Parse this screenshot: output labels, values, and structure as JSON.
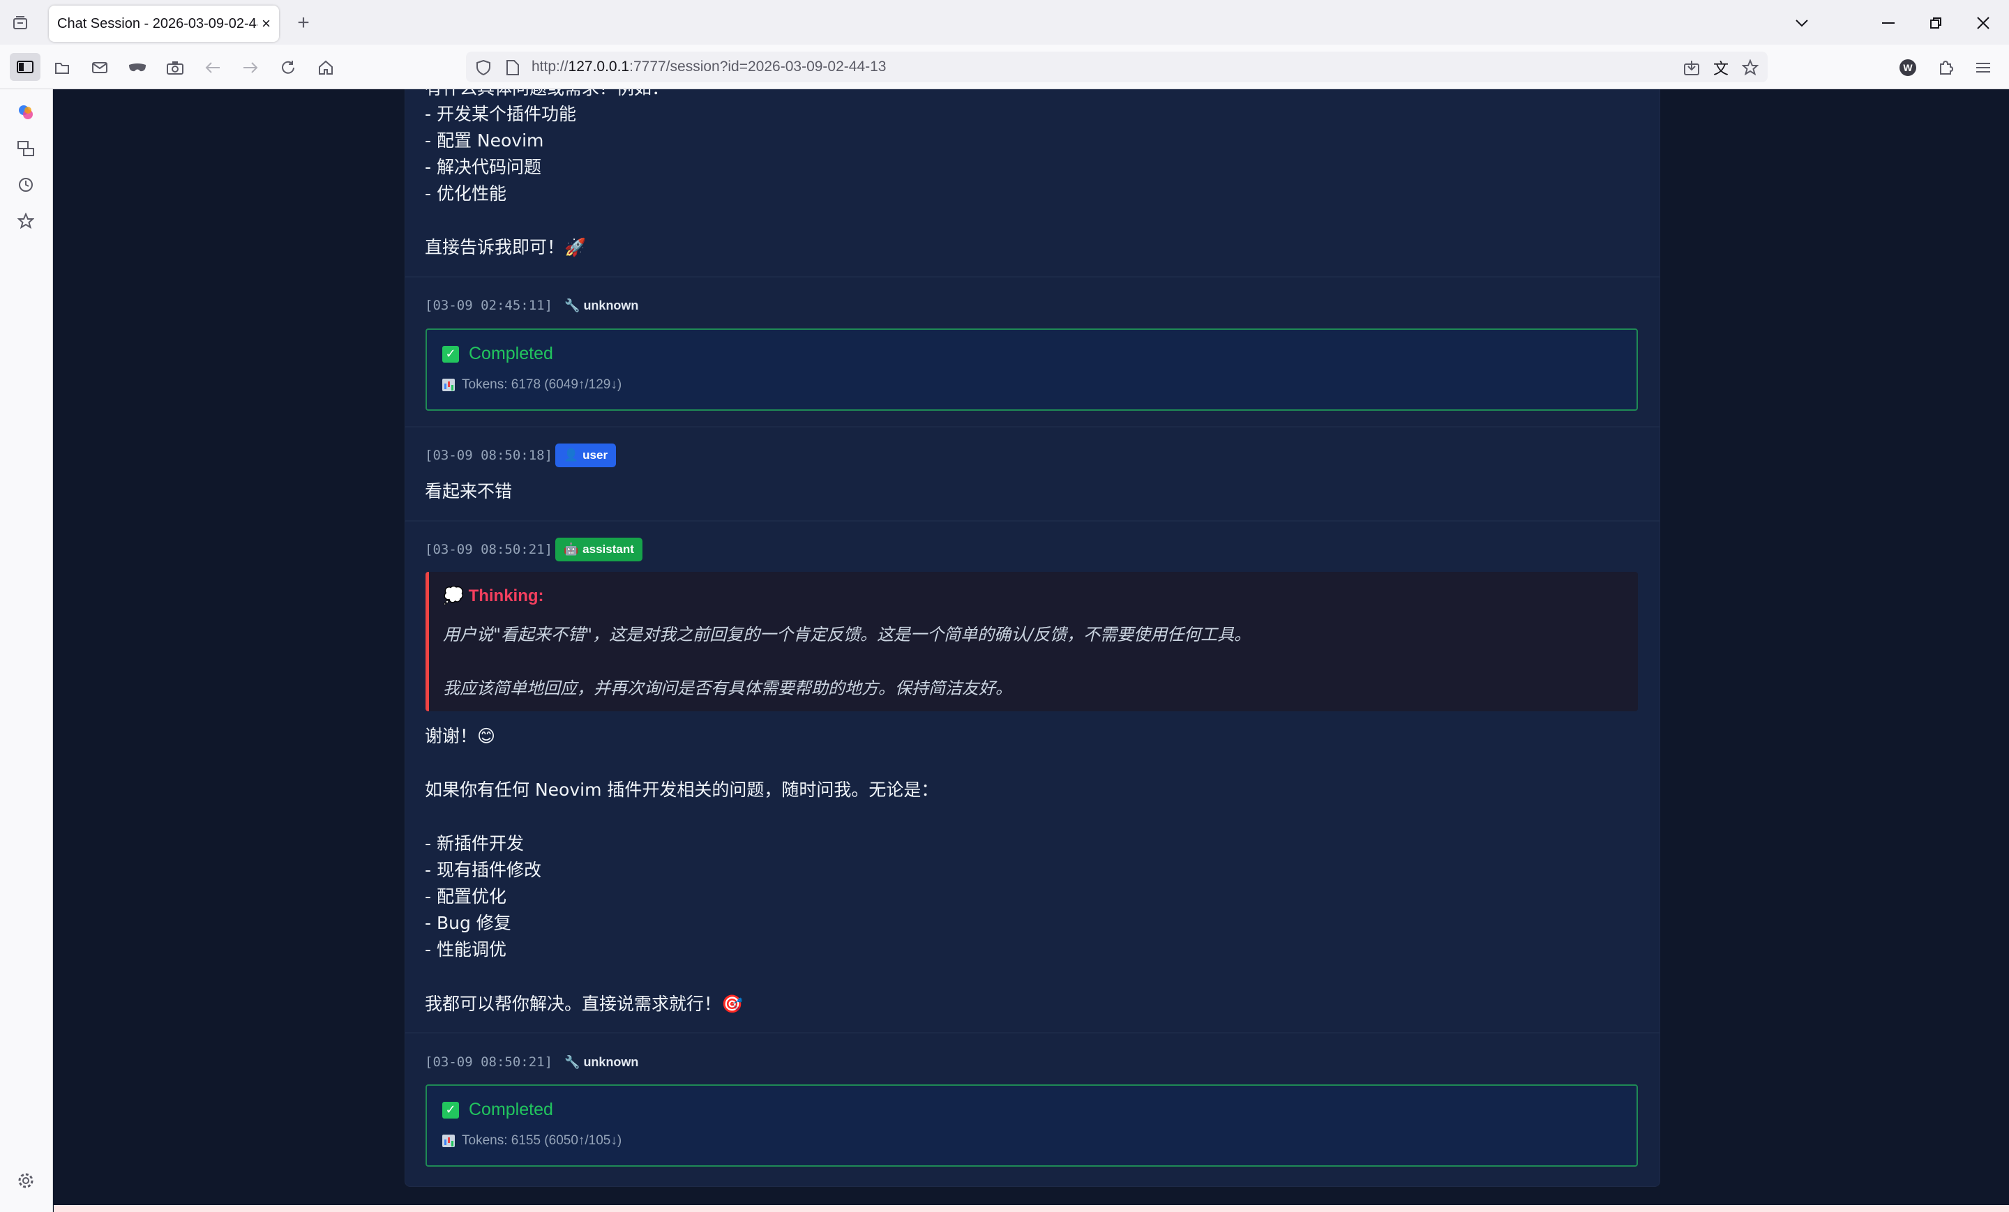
{
  "browser": {
    "tab_title": "Chat Session - 2026-03-09-02-44-13",
    "url_prefix": "http://",
    "url_host": "127.0.0.1",
    "url_rest": ":7777/session?id=2026-03-09-02-44-13",
    "new_tab": "+",
    "close_tab": "×"
  },
  "messages": {
    "top_list": {
      "cut_line": "有什么具体问题或需求？例如：",
      "items": [
        "- 开发某个插件功能",
        "- 配置 Neovim",
        "- 解决代码问题",
        "- 优化性能"
      ],
      "closing": "直接告诉我即可！🚀"
    },
    "status1": {
      "timestamp": "[03-09 02:45:11]",
      "role_icon": "🔧",
      "role": "unknown",
      "status": "Completed",
      "tokens": "Tokens: 6178 (6049↑/129↓)"
    },
    "user1": {
      "timestamp": "[03-09 08:50:18]",
      "role_icon": "👤",
      "role": "user",
      "text": "看起来不错"
    },
    "assistant1": {
      "timestamp": "[03-09 08:50:21]",
      "role_icon": "🤖",
      "role": "assistant",
      "thinking_icon": "💭",
      "thinking_title": "Thinking:",
      "thinking_line1": "用户说\"看起来不错\"，这是对我之前回复的一个肯定反馈。这是一个简单的确认/反馈，不需要使用任何工具。",
      "thinking_line2": "我应该简单地回应，并再次询问是否有具体需要帮助的地方。保持简洁友好。",
      "thanks": "谢谢！😊",
      "intro": "如果你有任何 Neovim 插件开发相关的问题，随时问我。无论是：",
      "items": [
        "- 新插件开发",
        "- 现有插件修改",
        "- 配置优化",
        "- Bug 修复",
        "- 性能调优"
      ],
      "closing": "我都可以帮你解决。直接说需求就行！🎯"
    },
    "status2": {
      "timestamp": "[03-09 08:50:21]",
      "role_icon": "🔧",
      "role": "unknown",
      "status": "Completed",
      "tokens": "Tokens: 6155 (6050↑/105↓)"
    }
  },
  "colors": {
    "page_bg": "#0f172a",
    "card_bg": "#162341",
    "user_badge": "#2563eb",
    "assistant_badge": "#16a34a",
    "completed": "#22c55e",
    "thinking_accent": "#ef4444"
  },
  "icons": [
    "list-all-tabs-icon",
    "sidebar-toggle-icon",
    "folder-icon",
    "mail-icon",
    "mask-icon",
    "camera-icon",
    "back-icon",
    "forward-icon",
    "reload-icon",
    "home-icon",
    "shield-icon",
    "page-icon",
    "download-icon",
    "translate-icon",
    "star-icon",
    "account-icon",
    "extensions-icon",
    "menu-icon",
    "chevron-down-icon",
    "minimize-icon",
    "restore-icon",
    "close-icon",
    "copilot-icon",
    "sync-icon",
    "history-icon",
    "bookmarks-icon",
    "settings-icon"
  ]
}
